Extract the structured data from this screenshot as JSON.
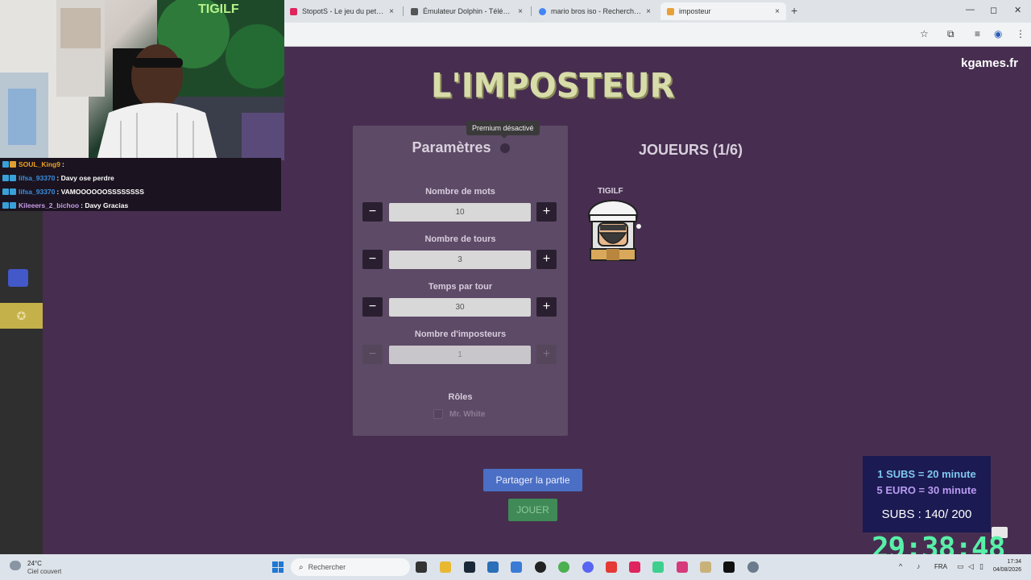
{
  "browser": {
    "tabs": [
      {
        "title": "StopotS - Le jeu du petit bac en ligne",
        "active": false,
        "favicon_color": "#e0245e"
      },
      {
        "title": "Émulateur Dolphin - Télécharger",
        "active": false,
        "favicon_color": "#555555"
      },
      {
        "title": "mario bros iso - Recherche Google",
        "active": false,
        "favicon_color": "#4285f4"
      },
      {
        "title": "imposteur",
        "active": true,
        "favicon_color": "#e8a13a"
      }
    ],
    "close_glyph": "×",
    "new_tab_glyph": "+",
    "window": {
      "minimize": "—",
      "maximize": "◻",
      "close": "✕"
    },
    "toolbar_icons": [
      "star-icon",
      "extension-icon",
      "media-icon",
      "profile-icon",
      "menu-icon"
    ]
  },
  "page": {
    "site_name": "kgames.fr",
    "logo_text": "L'IMPOSTEUR",
    "settings": {
      "title": "Paramètres",
      "tooltip": "Premium désactivé",
      "rows": [
        {
          "label": "Nombre de mots",
          "value": "10",
          "disabled": false
        },
        {
          "label": "Nombre de tours",
          "value": "3",
          "disabled": false
        },
        {
          "label": "Temps par tour",
          "value": "30",
          "disabled": false
        },
        {
          "label": "Nombre d'imposteurs",
          "value": "1",
          "disabled": true
        }
      ],
      "minus_glyph": "−",
      "plus_glyph": "+",
      "roles_label": "Rôles",
      "roles": [
        {
          "label": "Mr. White",
          "checked": false
        }
      ]
    },
    "players": {
      "title": "JOUEURS (1/6)",
      "list": [
        {
          "name": "TIGILF"
        }
      ]
    },
    "share_button": "Partager la partie",
    "play_button": "JOUER"
  },
  "stream": {
    "chat": [
      {
        "user": "SOUL_King9",
        "user_color": "#f0a020",
        "message": ""
      },
      {
        "user": "lifsa_93370",
        "user_color": "#3b8fe0",
        "message": "Davy ose perdre"
      },
      {
        "user": "lifsa_93370",
        "user_color": "#3b8fe0",
        "message": "VAMOOOOOOSSSSSSSS"
      },
      {
        "user": "Kileeers_2_bichoo",
        "user_color": "#c89ce8",
        "message": "Davy Gracias"
      }
    ],
    "webcam_text": "TIGILF",
    "subs_goal": {
      "line1": "1 SUBS = 20 minute",
      "line2": "5 EURO = 30 minute",
      "line3": "SUBS : 140/ 200"
    },
    "timer": "29:38:48"
  },
  "taskbar": {
    "weather_temp": "24°C",
    "weather_desc": "Ciel couvert",
    "search_placeholder": "Rechercher",
    "language": "FRA",
    "time": "17:34",
    "date": "04/08/2026"
  }
}
